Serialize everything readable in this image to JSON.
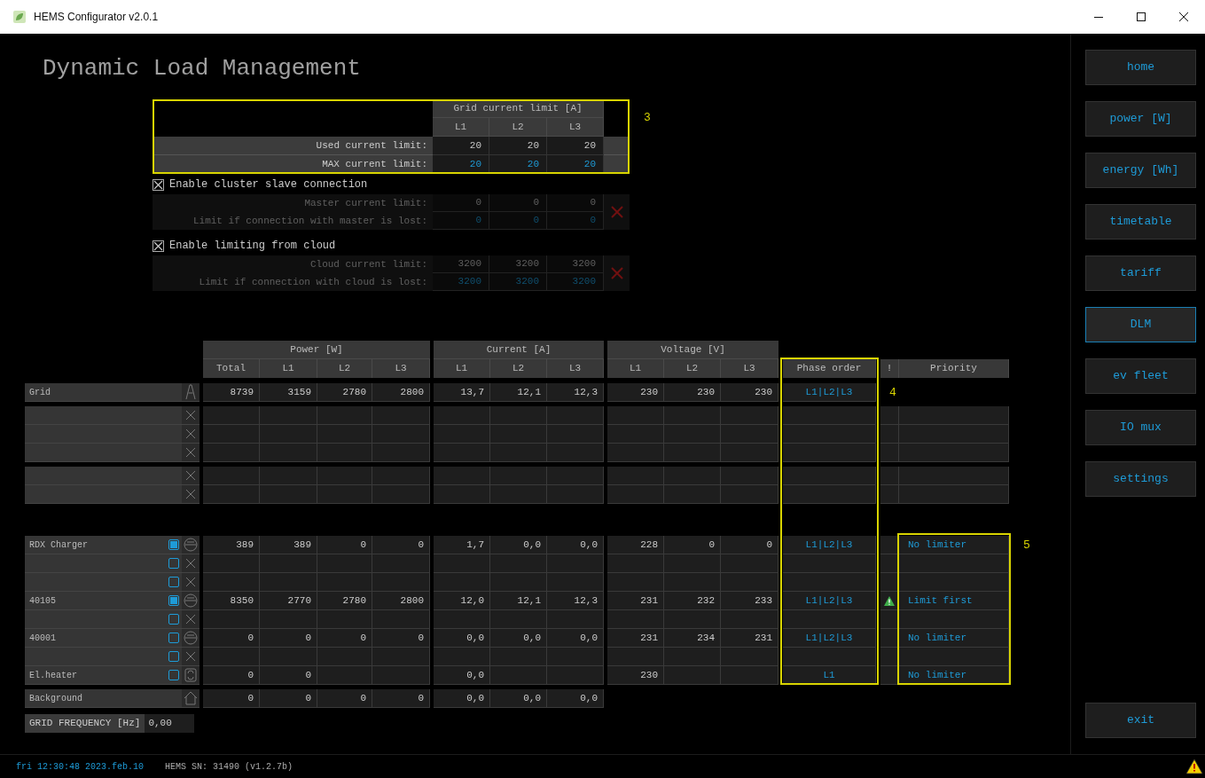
{
  "window": {
    "title": "HEMS Configurator v2.0.1"
  },
  "page_title": "Dynamic Load Management",
  "limits": {
    "header": "Grid current limit [A]",
    "columns": [
      "L1",
      "L2",
      "L3"
    ],
    "rows": [
      {
        "label": "Used current limit:",
        "values": [
          "20",
          "20",
          "20"
        ],
        "editable": false
      },
      {
        "label": "MAX current limit:",
        "values": [
          "20",
          "20",
          "20"
        ],
        "editable": true
      }
    ]
  },
  "options": [
    {
      "label": "Enable cluster slave connection",
      "checked": true,
      "table": {
        "disabled": true,
        "rows": [
          {
            "label": "Master current limit:",
            "values": [
              "0",
              "0",
              "0"
            ],
            "editable": false
          },
          {
            "label": "Limit if connection with master is lost:",
            "values": [
              "0",
              "0",
              "0"
            ],
            "editable": true
          }
        ]
      }
    },
    {
      "label": "Enable limiting from cloud",
      "checked": true,
      "table": {
        "disabled": true,
        "rows": [
          {
            "label": "Cloud current limit:",
            "values": [
              "3200",
              "3200",
              "3200"
            ],
            "editable": false
          },
          {
            "label": "Limit if connection with cloud is lost:",
            "values": [
              "3200",
              "3200",
              "3200"
            ],
            "editable": true
          }
        ]
      }
    }
  ],
  "main_table": {
    "groups": [
      {
        "label": "Power [W]",
        "columns": [
          "Total",
          "L1",
          "L2",
          "L3"
        ]
      },
      {
        "label": "Current [A]",
        "columns": [
          "L1",
          "L2",
          "L3"
        ]
      },
      {
        "label": "Voltage [V]",
        "columns": [
          "L1",
          "L2",
          "L3"
        ]
      }
    ],
    "phase_header": "Phase order",
    "alert_header": "!",
    "priority_header": "Priority",
    "sections": [
      {
        "kind": "grid",
        "rows": [
          {
            "kind": "grid",
            "name": "Grid",
            "power": [
              "8739",
              "3159",
              "2780",
              "2800"
            ],
            "current": [
              "13,7",
              "12,1",
              "12,3"
            ],
            "voltage": [
              "230",
              "230",
              "230"
            ],
            "phase": "L1|L2|L3"
          }
        ]
      },
      {
        "kind": "slots",
        "rows": [
          {
            "kind": "empty"
          },
          {
            "kind": "empty"
          },
          {
            "kind": "empty"
          }
        ]
      },
      {
        "kind": "slots",
        "rows": [
          {
            "kind": "empty"
          },
          {
            "kind": "empty"
          }
        ]
      },
      {
        "kind": "devices",
        "rows": [
          {
            "kind": "device",
            "name": "RDX Charger",
            "checked": true,
            "power": [
              "389",
              "389",
              "0",
              "0"
            ],
            "current": [
              "1,7",
              "0,0",
              "0,0"
            ],
            "voltage": [
              "228",
              "0",
              "0"
            ],
            "phase": "L1|L2|L3",
            "warning": false,
            "priority": "No limiter"
          },
          {
            "kind": "empty",
            "checked": false,
            "warning": false
          },
          {
            "kind": "empty",
            "checked": false,
            "warning": false
          },
          {
            "kind": "device",
            "name": "40105",
            "checked": true,
            "power": [
              "8350",
              "2770",
              "2780",
              "2800"
            ],
            "current": [
              "12,0",
              "12,1",
              "12,3"
            ],
            "voltage": [
              "231",
              "232",
              "233"
            ],
            "phase": "L1|L2|L3",
            "warning": true,
            "priority": "Limit first"
          },
          {
            "kind": "empty",
            "checked": false,
            "warning": false
          },
          {
            "kind": "device",
            "name": "40001",
            "checked": false,
            "power": [
              "0",
              "0",
              "0",
              "0"
            ],
            "current": [
              "0,0",
              "0,0",
              "0,0"
            ],
            "voltage": [
              "231",
              "234",
              "231"
            ],
            "phase": "L1|L2|L3",
            "warning": false,
            "priority": "No limiter"
          },
          {
            "kind": "empty",
            "checked": false,
            "warning": false
          },
          {
            "kind": "heater",
            "name": "El.heater",
            "checked": false,
            "power": [
              "0",
              "0"
            ],
            "current": [
              "0,0"
            ],
            "voltage": [
              "230"
            ],
            "phase": "L1",
            "warning": false,
            "priority": "No limiter"
          }
        ]
      },
      {
        "kind": "background",
        "rows": [
          {
            "kind": "background",
            "name": "Background",
            "power": [
              "0",
              "0",
              "0",
              "0"
            ],
            "current": [
              "0,0",
              "0,0",
              "0,0"
            ]
          }
        ]
      }
    ]
  },
  "grid_frequency": {
    "label": "GRID FREQUENCY [Hz]",
    "value": "0,00"
  },
  "sidebar": {
    "items": [
      {
        "label": "home",
        "selected": false
      },
      {
        "label": "power [W]",
        "selected": false
      },
      {
        "label": "energy [Wh]",
        "selected": false
      },
      {
        "label": "timetable",
        "selected": false
      },
      {
        "label": "tariff",
        "selected": false
      },
      {
        "label": "DLM",
        "selected": true
      },
      {
        "label": "ev fleet",
        "selected": false
      },
      {
        "label": "IO mux",
        "selected": false
      },
      {
        "label": "settings",
        "selected": false
      }
    ],
    "exit": "exit"
  },
  "status_bar": {
    "datetime": "fri 12:30:48 2023.feb.10",
    "serial": "HEMS SN: 31490 (v1.2.7b)",
    "warning": true
  },
  "annotations": [
    {
      "label": "3"
    },
    {
      "label": "4"
    },
    {
      "label": "5"
    }
  ]
}
